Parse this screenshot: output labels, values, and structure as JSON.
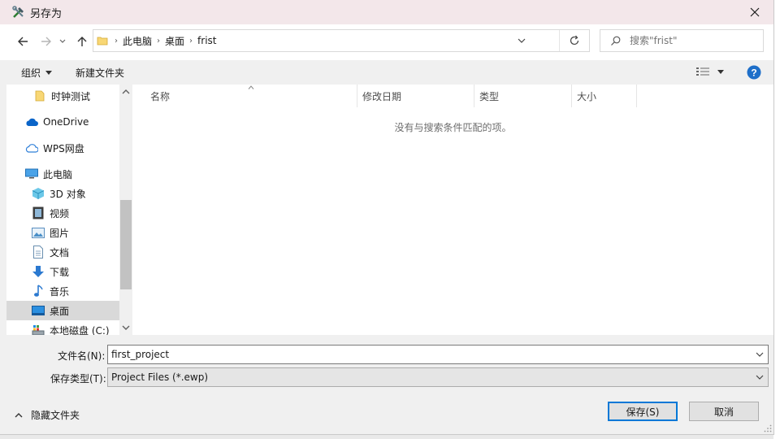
{
  "window": {
    "title": "另存为"
  },
  "address": {
    "breadcrumbs": [
      "此电脑",
      "桌面",
      "frist"
    ],
    "search_placeholder": "搜索\"frist\""
  },
  "toolbar": {
    "organize": "组织",
    "new_folder": "新建文件夹"
  },
  "nav_pane": {
    "items": [
      {
        "label": "时钟测试",
        "icon": "folder-icon"
      },
      {
        "label": "OneDrive",
        "icon": "onedrive-cloud-icon"
      },
      {
        "label": "WPS网盘",
        "icon": "wps-cloud-icon"
      },
      {
        "label": "此电脑",
        "icon": "computer-icon"
      },
      {
        "label": "3D 对象",
        "icon": "3d-objects-icon"
      },
      {
        "label": "视频",
        "icon": "video-icon"
      },
      {
        "label": "图片",
        "icon": "pictures-icon"
      },
      {
        "label": "文档",
        "icon": "documents-icon"
      },
      {
        "label": "下载",
        "icon": "download-icon"
      },
      {
        "label": "音乐",
        "icon": "music-icon"
      },
      {
        "label": "桌面",
        "icon": "desktop-icon",
        "selected": true
      },
      {
        "label": "本地磁盘 (C:)",
        "icon": "drive-icon"
      }
    ]
  },
  "file_list": {
    "columns": [
      "名称",
      "修改日期",
      "类型",
      "大小"
    ],
    "empty_message": "没有与搜索条件匹配的项。"
  },
  "form": {
    "filename_label": "文件名(N):",
    "filename_value": "first_project",
    "filetype_label": "保存类型(T):",
    "filetype_value": "Project Files (*.ewp)"
  },
  "footer": {
    "hide_folders": "隐藏文件夹",
    "save": "保存(S)",
    "cancel": "取消"
  },
  "colors": {
    "accent": "#0078d7",
    "help": "#1e6fc9",
    "folder": "#f8d775"
  }
}
